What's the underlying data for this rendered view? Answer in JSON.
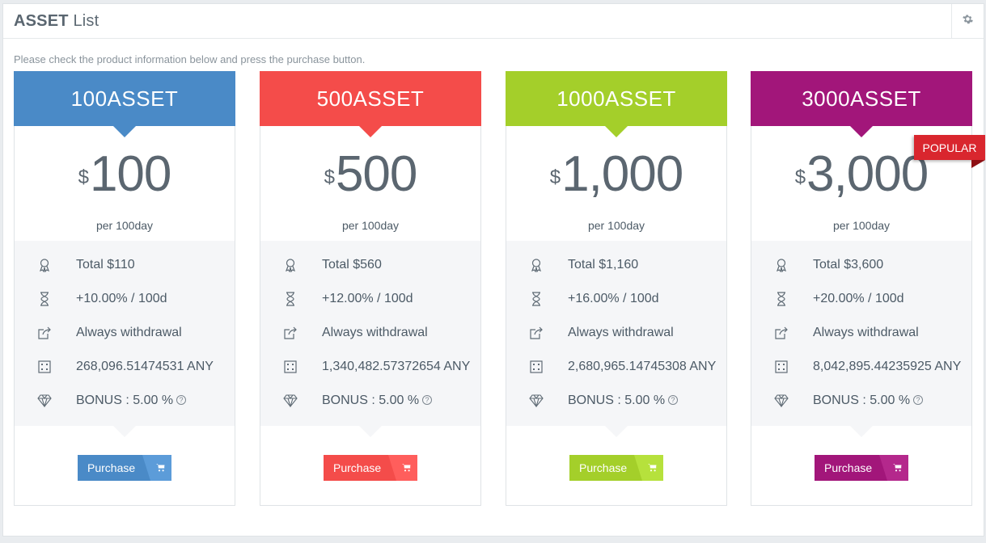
{
  "header": {
    "title_bold": "ASSET",
    "title_rest": "List",
    "settings_icon": "gear-icon"
  },
  "description": "Please check the product information below and press the purchase button.",
  "colors": {
    "blue": "#4a8ac7",
    "red": "#f44c4a",
    "green": "#a4cf2a",
    "purple": "#a2167a",
    "ribbon": "#d9262e"
  },
  "ribbon": {
    "label": "POPULAR"
  },
  "plans": [
    {
      "name": "100ASSET",
      "currency": "$",
      "price": "100",
      "period": "per 100day",
      "color": "#4a8ac7",
      "features": {
        "total": "Total $110",
        "rate": "+10.00% / 100d",
        "withdrawal": "Always withdrawal",
        "amount": "268,096.51474531 ANY",
        "bonus": "BONUS : 5.00 %"
      },
      "button_label": "Purchase"
    },
    {
      "name": "500ASSET",
      "currency": "$",
      "price": "500",
      "period": "per 100day",
      "color": "#f44c4a",
      "features": {
        "total": "Total $560",
        "rate": "+12.00% / 100d",
        "withdrawal": "Always withdrawal",
        "amount": "1,340,482.57372654 ANY",
        "bonus": "BONUS : 5.00 %"
      },
      "button_label": "Purchase"
    },
    {
      "name": "1000ASSET",
      "currency": "$",
      "price": "1,000",
      "period": "per 100day",
      "color": "#a4cf2a",
      "features": {
        "total": "Total $1,160",
        "rate": "+16.00% / 100d",
        "withdrawal": "Always withdrawal",
        "amount": "2,680,965.14745308 ANY",
        "bonus": "BONUS : 5.00 %"
      },
      "button_label": "Purchase"
    },
    {
      "name": "3000ASSET",
      "currency": "$",
      "price": "3,000",
      "period": "per 100day",
      "color": "#a2167a",
      "features": {
        "total": "Total $3,600",
        "rate": "+20.00% / 100d",
        "withdrawal": "Always withdrawal",
        "amount": "8,042,895.44235925 ANY",
        "bonus": "BONUS : 5.00 %"
      },
      "button_label": "Purchase"
    }
  ],
  "feature_icons": [
    "award-icon",
    "hourglass-icon",
    "share-icon",
    "calculator-icon",
    "diamond-icon"
  ],
  "help_icon": "question-circle-icon",
  "cart_icon": "cart-icon"
}
